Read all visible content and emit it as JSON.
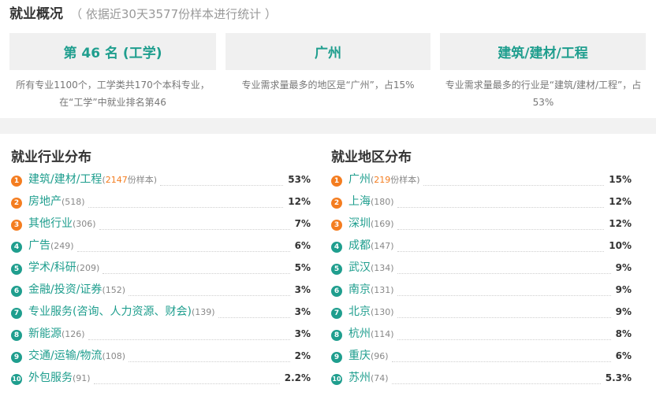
{
  "header": {
    "title": "就业概况",
    "subtitle": "（ 依据近30天3577份样本进行统计 ）"
  },
  "cards": [
    {
      "value": "第 46 名 (工学)",
      "desc": "所有专业1100个，工学类共170个本科专业，在“工学”中就业排名第46"
    },
    {
      "value": "广州",
      "desc": "专业需求量最多的地区是“广州”，占15%"
    },
    {
      "value": "建筑/建材/工程",
      "desc": "专业需求量最多的行业是“建筑/建材/工程”，占53%"
    }
  ],
  "industry": {
    "title": "就业行业分布",
    "sample_suffix": "份样本",
    "items": [
      {
        "rank": "1",
        "name": "建筑/建材/工程",
        "count": "2147",
        "pct": "53%"
      },
      {
        "rank": "2",
        "name": "房地产",
        "count": "518",
        "pct": "12%"
      },
      {
        "rank": "3",
        "name": "其他行业",
        "count": "306",
        "pct": "7%"
      },
      {
        "rank": "4",
        "name": "广告",
        "count": "249",
        "pct": "6%"
      },
      {
        "rank": "5",
        "name": "学术/科研",
        "count": "209",
        "pct": "5%"
      },
      {
        "rank": "6",
        "name": "金融/投资/证券",
        "count": "152",
        "pct": "3%"
      },
      {
        "rank": "7",
        "name": "专业服务(咨询、人力资源、财会)",
        "count": "139",
        "pct": "3%"
      },
      {
        "rank": "8",
        "name": "新能源",
        "count": "126",
        "pct": "3%"
      },
      {
        "rank": "9",
        "name": "交通/运输/物流",
        "count": "108",
        "pct": "2%"
      },
      {
        "rank": "10",
        "name": "外包服务",
        "count": "91",
        "pct": "2.2%"
      }
    ]
  },
  "region": {
    "title": "就业地区分布",
    "sample_suffix": "份样本",
    "items": [
      {
        "rank": "1",
        "name": "广州",
        "count": "219",
        "pct": "15%"
      },
      {
        "rank": "2",
        "name": "上海",
        "count": "180",
        "pct": "12%"
      },
      {
        "rank": "3",
        "name": "深圳",
        "count": "169",
        "pct": "12%"
      },
      {
        "rank": "4",
        "name": "成都",
        "count": "147",
        "pct": "10%"
      },
      {
        "rank": "5",
        "name": "武汉",
        "count": "134",
        "pct": "9%"
      },
      {
        "rank": "6",
        "name": "南京",
        "count": "131",
        "pct": "9%"
      },
      {
        "rank": "7",
        "name": "北京",
        "count": "130",
        "pct": "9%"
      },
      {
        "rank": "8",
        "name": "杭州",
        "count": "114",
        "pct": "8%"
      },
      {
        "rank": "9",
        "name": "重庆",
        "count": "96",
        "pct": "6%"
      },
      {
        "rank": "10",
        "name": "苏州",
        "count": "74",
        "pct": "5.3%"
      }
    ]
  },
  "colors": {
    "accent": "#1f9e8e",
    "rank_top": "#f47d20",
    "card_bg": "#f0f0f0"
  }
}
